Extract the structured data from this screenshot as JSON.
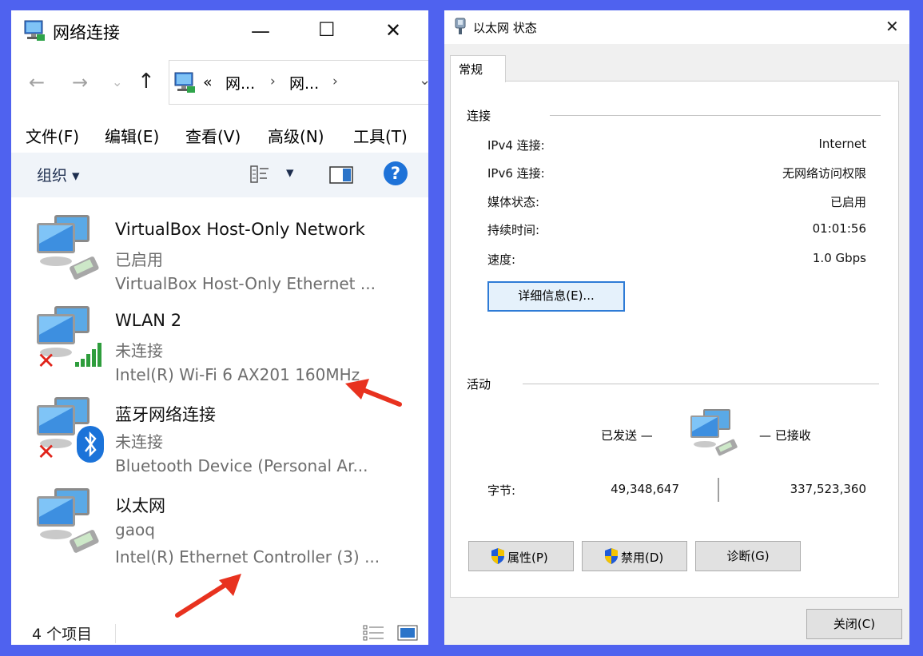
{
  "network_window": {
    "title": "网络连接",
    "caption": {
      "minimize": "—",
      "maximize": "☐",
      "close": "✕"
    },
    "address_parts": [
      "«",
      "网...",
      "›",
      "网...",
      "›"
    ],
    "menu": [
      "文件(F)",
      "编辑(E)",
      "查看(V)",
      "高级(N)",
      "工具(T)"
    ],
    "toolbar": {
      "organize": "组织 ▾",
      "view_dropdown": "▾"
    },
    "connections": [
      {
        "name": "VirtualBox Host-Only Network",
        "status": "已启用",
        "device": "VirtualBox Host-Only Ethernet ...",
        "overlay": "cable-icon"
      },
      {
        "name": "WLAN 2",
        "status": "未连接",
        "device": "Intel(R) Wi-Fi 6 AX201 160MHz",
        "overlay": "wifi-signal-icon"
      },
      {
        "name": "蓝牙网络连接",
        "status": "未连接",
        "device": "Bluetooth Device (Personal Ar...",
        "overlay": "bluetooth-icon"
      },
      {
        "name": "以太网",
        "status": "gaoq",
        "device": "Intel(R) Ethernet Controller (3) ...",
        "overlay": "cable-icon"
      }
    ],
    "item_count": "4 个项目"
  },
  "status_window": {
    "title": "以太网 状态",
    "close": "✕",
    "tab": "常规",
    "connection": {
      "group": "连接",
      "rows": [
        {
          "label": "IPv4 连接:",
          "value": "Internet"
        },
        {
          "label": "IPv6 连接:",
          "value": "无网络访问权限"
        },
        {
          "label": "媒体状态:",
          "value": "已启用"
        },
        {
          "label": "持续时间:",
          "value": "01:01:56"
        },
        {
          "label": "速度:",
          "value": "1.0 Gbps"
        }
      ],
      "details_button": "详细信息(E)..."
    },
    "activity": {
      "group": "活动",
      "sent_label": "已发送 —",
      "received_label": "— 已接收",
      "bytes_label": "字节:",
      "bytes_sent": "49,348,647",
      "bytes_received": "337,523,360"
    },
    "buttons": {
      "properties": "属性(P)",
      "disable": "禁用(D)",
      "diagnose": "诊断(G)",
      "close": "关闭(C)"
    }
  },
  "colors": {
    "background": "#4f62ef",
    "annotation_arrow": "#e8321f",
    "help_blue": "#1e72d8",
    "shield_blue": "#1f5bd8",
    "shield_yellow": "#f4c300"
  }
}
